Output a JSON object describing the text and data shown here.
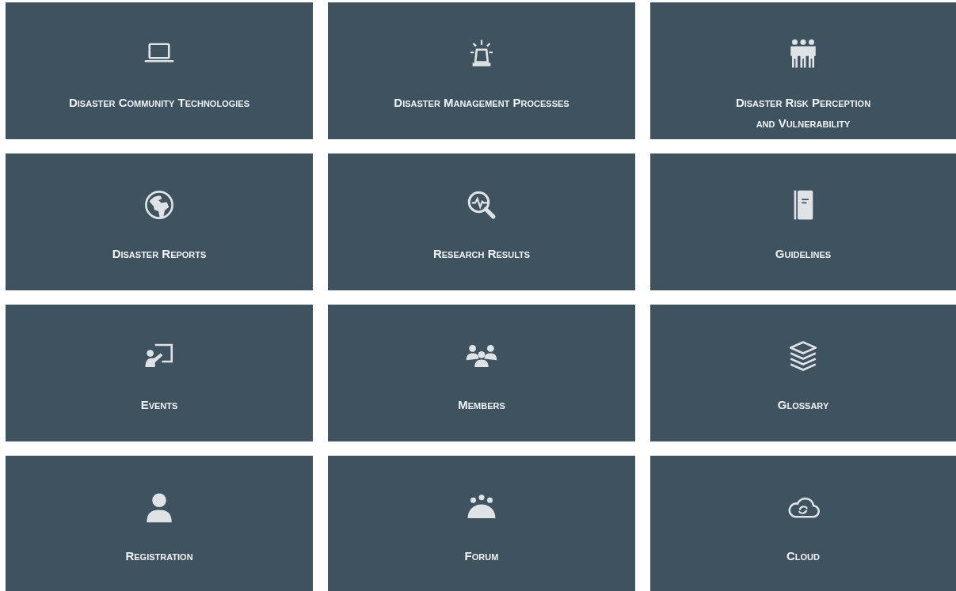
{
  "tiles": [
    {
      "lines": [
        "Disaster Community Technologies"
      ]
    },
    {
      "lines": [
        "Disaster Management Processes"
      ]
    },
    {
      "lines": [
        "Disaster Risk Perception",
        "and Vulnerability"
      ]
    },
    {
      "lines": [
        "Disaster Reports"
      ]
    },
    {
      "lines": [
        "Research Results"
      ]
    },
    {
      "lines": [
        "Guidelines"
      ]
    },
    {
      "lines": [
        "Events"
      ]
    },
    {
      "lines": [
        "Members"
      ]
    },
    {
      "lines": [
        "Glossary"
      ]
    },
    {
      "lines": [
        "Registration"
      ]
    },
    {
      "lines": [
        "Forum"
      ]
    },
    {
      "lines": [
        "Cloud"
      ]
    }
  ]
}
